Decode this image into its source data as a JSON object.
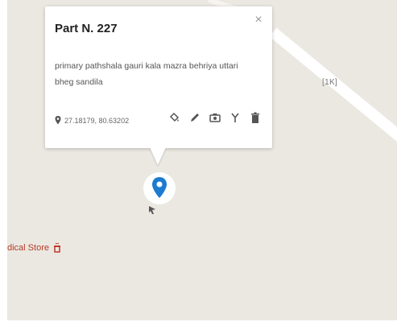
{
  "map": {
    "road_label": "[1K]",
    "store_label": "dical Store",
    "background_color": "#ebe8e2",
    "road_color": "#ffffff"
  },
  "info_window": {
    "title": "Part N. 227",
    "description": "primary pathshala gauri kala mazra behriya uttari bheg sandila",
    "coordinates": "27.18179, 80.63202",
    "close_label": "×",
    "tools": [
      "paint-bucket-icon",
      "pencil-icon",
      "camera-icon",
      "route-icon",
      "trash-icon"
    ]
  },
  "marker": {
    "color": "#1a7bd0"
  }
}
